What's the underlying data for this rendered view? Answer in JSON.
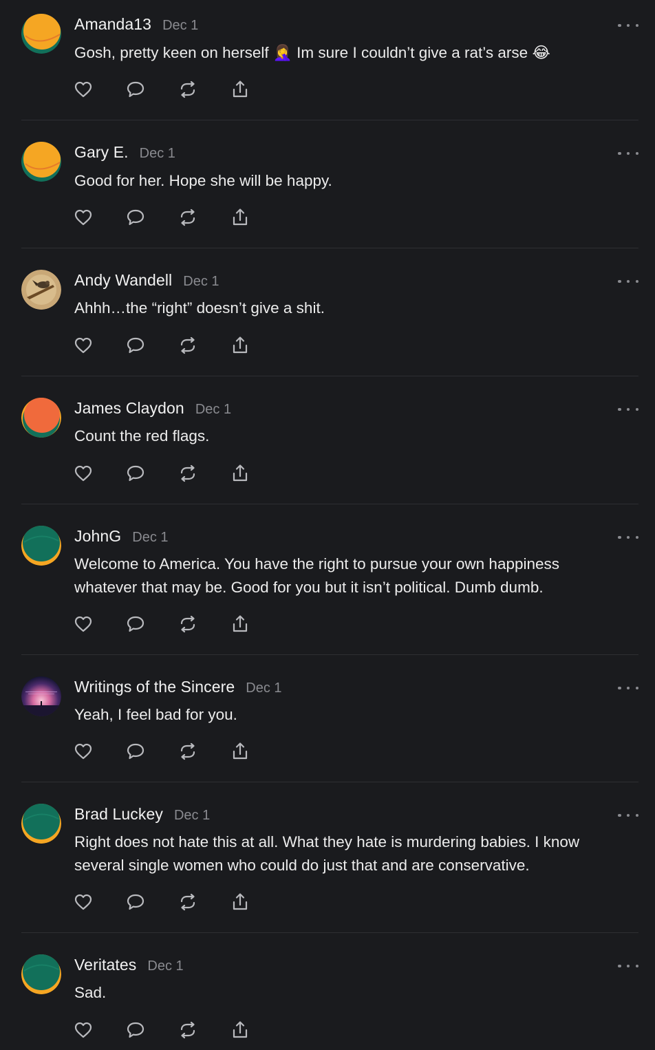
{
  "comments": [
    {
      "author": "Amanda13",
      "date": "Dec 1",
      "avatar": "orange-green",
      "lines": [
        "Gosh, pretty keen on herself 🤦‍♀️ Im sure I couldn’t give a rat’s arse 😂"
      ]
    },
    {
      "author": "Gary E.",
      "date": "Dec 1",
      "avatar": "orange-green",
      "lines": [
        "Good for her. Hope she will be happy."
      ]
    },
    {
      "author": "Andy Wandell",
      "date": "Dec 1",
      "avatar": "bird-photo",
      "lines": [
        "Ahhh…the “right” doesn’t give a shit."
      ]
    },
    {
      "author": "James Claydon",
      "date": "Dec 1",
      "avatar": "red-green",
      "lines": [
        "Count the red flags."
      ]
    },
    {
      "author": "JohnG",
      "date": "Dec 1",
      "avatar": "green-orange",
      "lines": [
        "Welcome to America. You have the right to pursue your own happiness",
        "whatever that may be. Good for you but it isn’t political. Dumb dumb."
      ]
    },
    {
      "author": "Writings of the Sincere",
      "date": "Dec 1",
      "avatar": "sunset-photo",
      "lines": [
        "Yeah, I feel bad for you."
      ]
    },
    {
      "author": "Brad Luckey",
      "date": "Dec 1",
      "avatar": "green-orange",
      "lines": [
        "Right does not hate this at all. What they hate is murdering babies. I know",
        "several single women who could do just that and are conservative."
      ]
    },
    {
      "author": "Veritates",
      "date": "Dec 1",
      "avatar": "green-orange",
      "lines": [
        "Sad."
      ]
    }
  ],
  "actions": {
    "like_icon": "heart-icon",
    "reply_icon": "speech-bubble-icon",
    "restack_icon": "restack-icon",
    "share_icon": "share-icon",
    "more_icon": "more-dots-icon"
  },
  "colors": {
    "background": "#1a1b1e",
    "text": "#ececec",
    "muted": "#8a8b90",
    "divider": "#2e2f33",
    "avatar_orange": "#f5a623",
    "avatar_green": "#12705a",
    "avatar_red": "#f06a3c"
  }
}
